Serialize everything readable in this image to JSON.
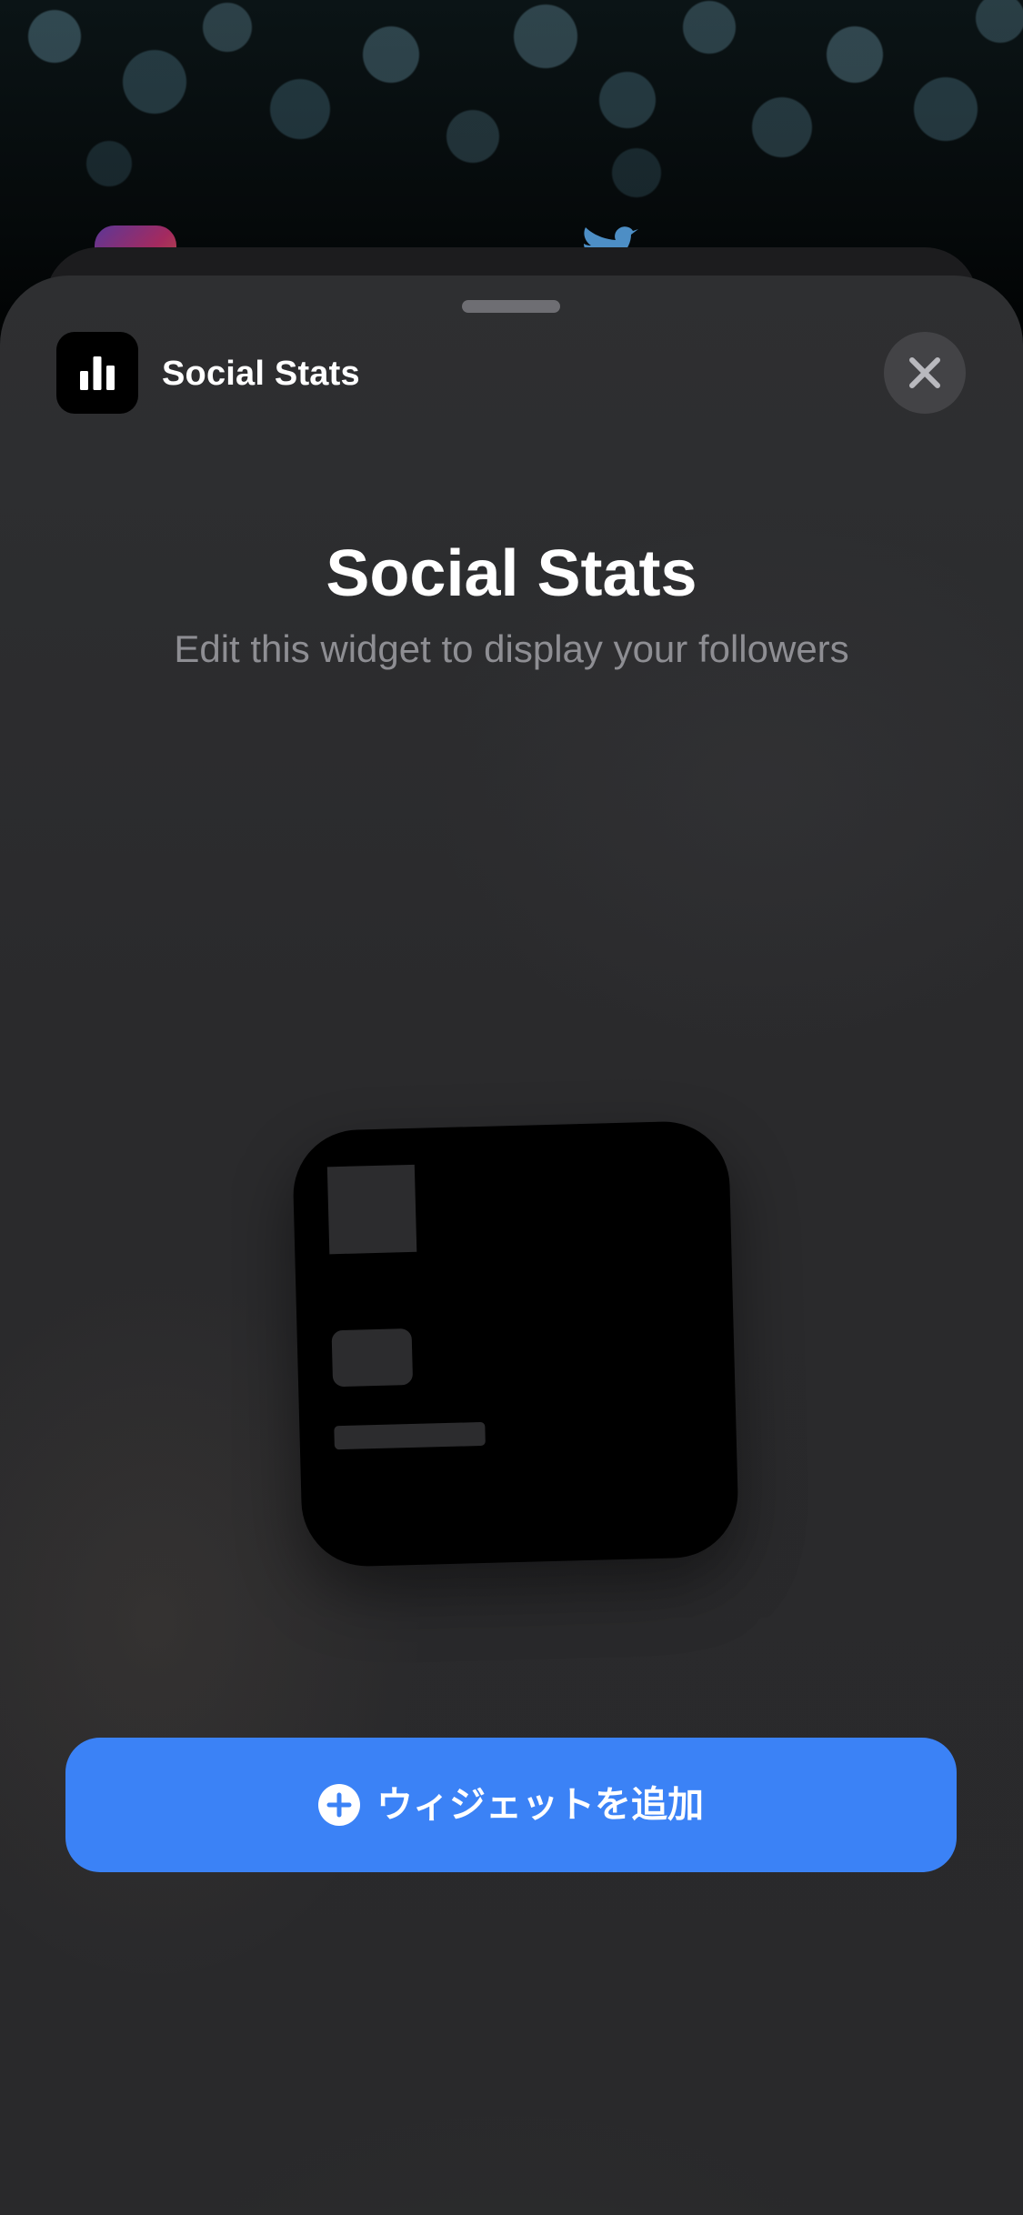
{
  "app": {
    "name": "Social Stats",
    "icon": "bar-chart-icon"
  },
  "widget": {
    "title": "Social Stats",
    "description": "Edit this widget to display your followers"
  },
  "actions": {
    "close_icon": "close-icon",
    "add_button_label": "ウィジェットを追加",
    "add_button_icon": "plus-circle-icon"
  },
  "colors": {
    "accent": "#3b82f6",
    "sheet_background": "#2c2c2e",
    "subtitle": "#8e8e93"
  }
}
